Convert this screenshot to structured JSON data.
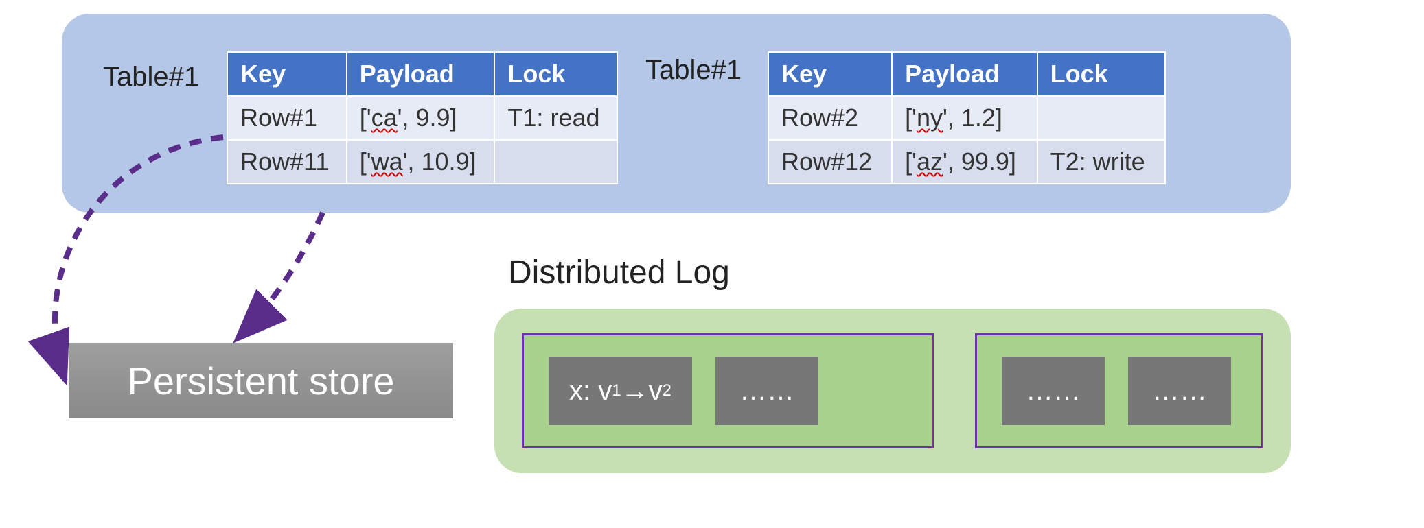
{
  "top_panel": {
    "left_table": {
      "label": "Table#1",
      "headers": [
        "Key",
        "Payload",
        "Lock"
      ],
      "rows": [
        {
          "key": "Row#1",
          "payload_pre": "['",
          "payload_word": "ca",
          "payload_post": "', 9.9]",
          "lock": "T1: read"
        },
        {
          "key": "Row#11",
          "payload_pre": "['",
          "payload_word": "wa",
          "payload_post": "', 10.9]",
          "lock": ""
        }
      ]
    },
    "right_table": {
      "label": "Table#1",
      "headers": [
        "Key",
        "Payload",
        "Lock"
      ],
      "rows": [
        {
          "key": "Row#2",
          "payload_pre": "['",
          "payload_word": "ny",
          "payload_post": "', 1.2]",
          "lock": ""
        },
        {
          "key": "Row#12",
          "payload_pre": "['",
          "payload_word": "az",
          "payload_post": "', 99.9]",
          "lock": "T2: write"
        }
      ]
    }
  },
  "persistent_store_label": "Persistent store",
  "distributed_log": {
    "title": "Distributed Log",
    "group1": {
      "entry1_html": "x: v<sub>1</sub>→v<sub>2</sub>",
      "entry2": "……"
    },
    "group2": {
      "entry1": "……",
      "entry2": "……"
    }
  },
  "colors": {
    "panel_blue": "#b4c7e7",
    "table_header": "#4472c4",
    "log_panel": "#c6e0b4",
    "log_group_bg": "#a9d18e",
    "log_group_border": "#7030a0",
    "arrow": "#5a2d8a"
  }
}
